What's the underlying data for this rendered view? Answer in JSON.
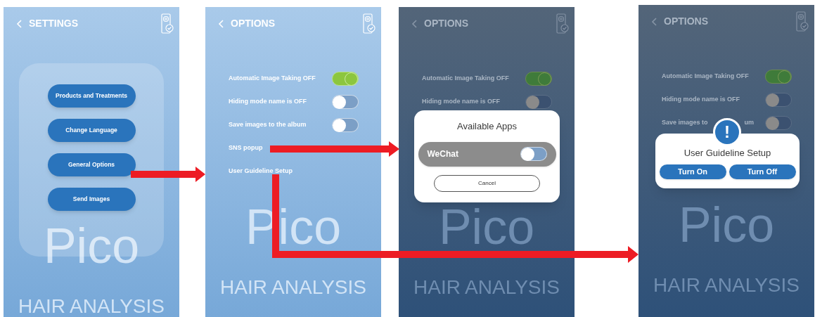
{
  "screens": [
    {
      "kind": "menu",
      "title": "SETTINGS",
      "dimmed": false,
      "watermark": [
        "Pico",
        "HAIR ANALYSIS"
      ],
      "buttons": [
        "Products and Treatments",
        "Change Language",
        "General Options",
        "Send Images"
      ]
    },
    {
      "kind": "options",
      "title": "OPTIONS",
      "dimmed": false,
      "watermark": [
        "Pico",
        "HAIR ANALYSIS"
      ],
      "options": [
        {
          "kind": "toggle",
          "label": "Automatic Image Taking OFF",
          "on": true
        },
        {
          "kind": "toggle",
          "label": "Hiding mode name is OFF",
          "on": false
        },
        {
          "kind": "toggle",
          "label": "Save images to the album",
          "on": false
        },
        {
          "kind": "link",
          "label": "SNS popup"
        },
        {
          "kind": "link",
          "label": "User Guideline Setup"
        }
      ]
    },
    {
      "kind": "options",
      "title": "OPTIONS",
      "dimmed": true,
      "watermark": [
        "Pico",
        "HAIR ANALYSIS"
      ],
      "options": [
        {
          "kind": "toggle",
          "label": "Automatic Image Taking OFF",
          "on": true
        },
        {
          "kind": "toggle",
          "label": "Hiding mode name is OFF",
          "on": false
        }
      ],
      "dialog": {
        "kind": "apps",
        "title": "Available Apps",
        "apps": [
          {
            "name": "WeChat",
            "on": false
          }
        ],
        "cancel": "Cancel"
      }
    },
    {
      "kind": "options",
      "title": "OPTIONS",
      "dimmed": true,
      "watermark": [
        "Pico",
        "HAIR ANALYSIS"
      ],
      "options": [
        {
          "kind": "toggle",
          "label": "Automatic Image Taking OFF",
          "on": true
        },
        {
          "kind": "toggle",
          "label": "Hiding mode name is OFF",
          "on": false
        },
        {
          "kind": "toggle",
          "label": "Save images to",
          "tail": "um",
          "on": false
        }
      ],
      "dialog": {
        "kind": "alert",
        "title": "User Guideline Setup",
        "icon": "!",
        "buttons": [
          "Turn On",
          "Turn Off"
        ]
      }
    }
  ]
}
